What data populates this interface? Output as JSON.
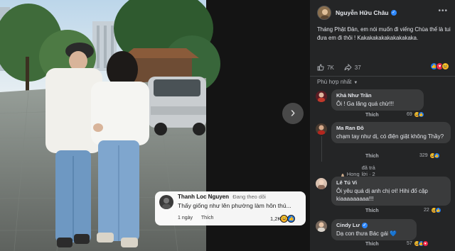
{
  "photo": {
    "next_icon": "chevron-right-icon",
    "overlay_comment": {
      "author": "Thanh Loc Nguyen",
      "status": "Đang theo dõi",
      "text": "Thấy giống như lên phường làm hôn thú...",
      "time": "1 ngày",
      "like_label": "Thích",
      "reaction_count": "1,2K"
    }
  },
  "post": {
    "author": "Nguyễn Hữu Châu",
    "verified": true,
    "caption": "Tháng Phật Đản, em nói muốn đi viếng Chùa thế là tui đưa em đi thôi ! Kakakakakakakakakaka.",
    "likes": "7K",
    "shares": "37",
    "sort_label": "Phù hợp nhất"
  },
  "comments": [
    {
      "author": "Khả Như Trần",
      "text": "Ôi ! Ga lăng quá chừ!!!",
      "like_label": "Thích",
      "reaction_count": "69"
    },
    {
      "author": "Ma Ran Đô",
      "text": "chạm tay như dị, có điện giật không Thầy?",
      "like_label": "Thích",
      "reaction_count": "329",
      "reply_author": "Hong Dao",
      "reply_text": "đã trả lời · 2 phản hồi"
    },
    {
      "author": "Lê Tú Vi",
      "text": "Ôi yêu quá dị anh chị ơi! Hihi đố cặp kiaaaaaaaaa!!!",
      "like_label": "Thích",
      "reaction_count": "22"
    },
    {
      "author": "Cindy Lư",
      "verified": true,
      "text": "Dạ con thưa Bác gái 💙",
      "like_label": "Thích",
      "reaction_count": "57"
    }
  ],
  "colors": {
    "panel_bg": "#242526",
    "bubble_bg": "#3a3b3c",
    "accent": "#2d88ff"
  }
}
